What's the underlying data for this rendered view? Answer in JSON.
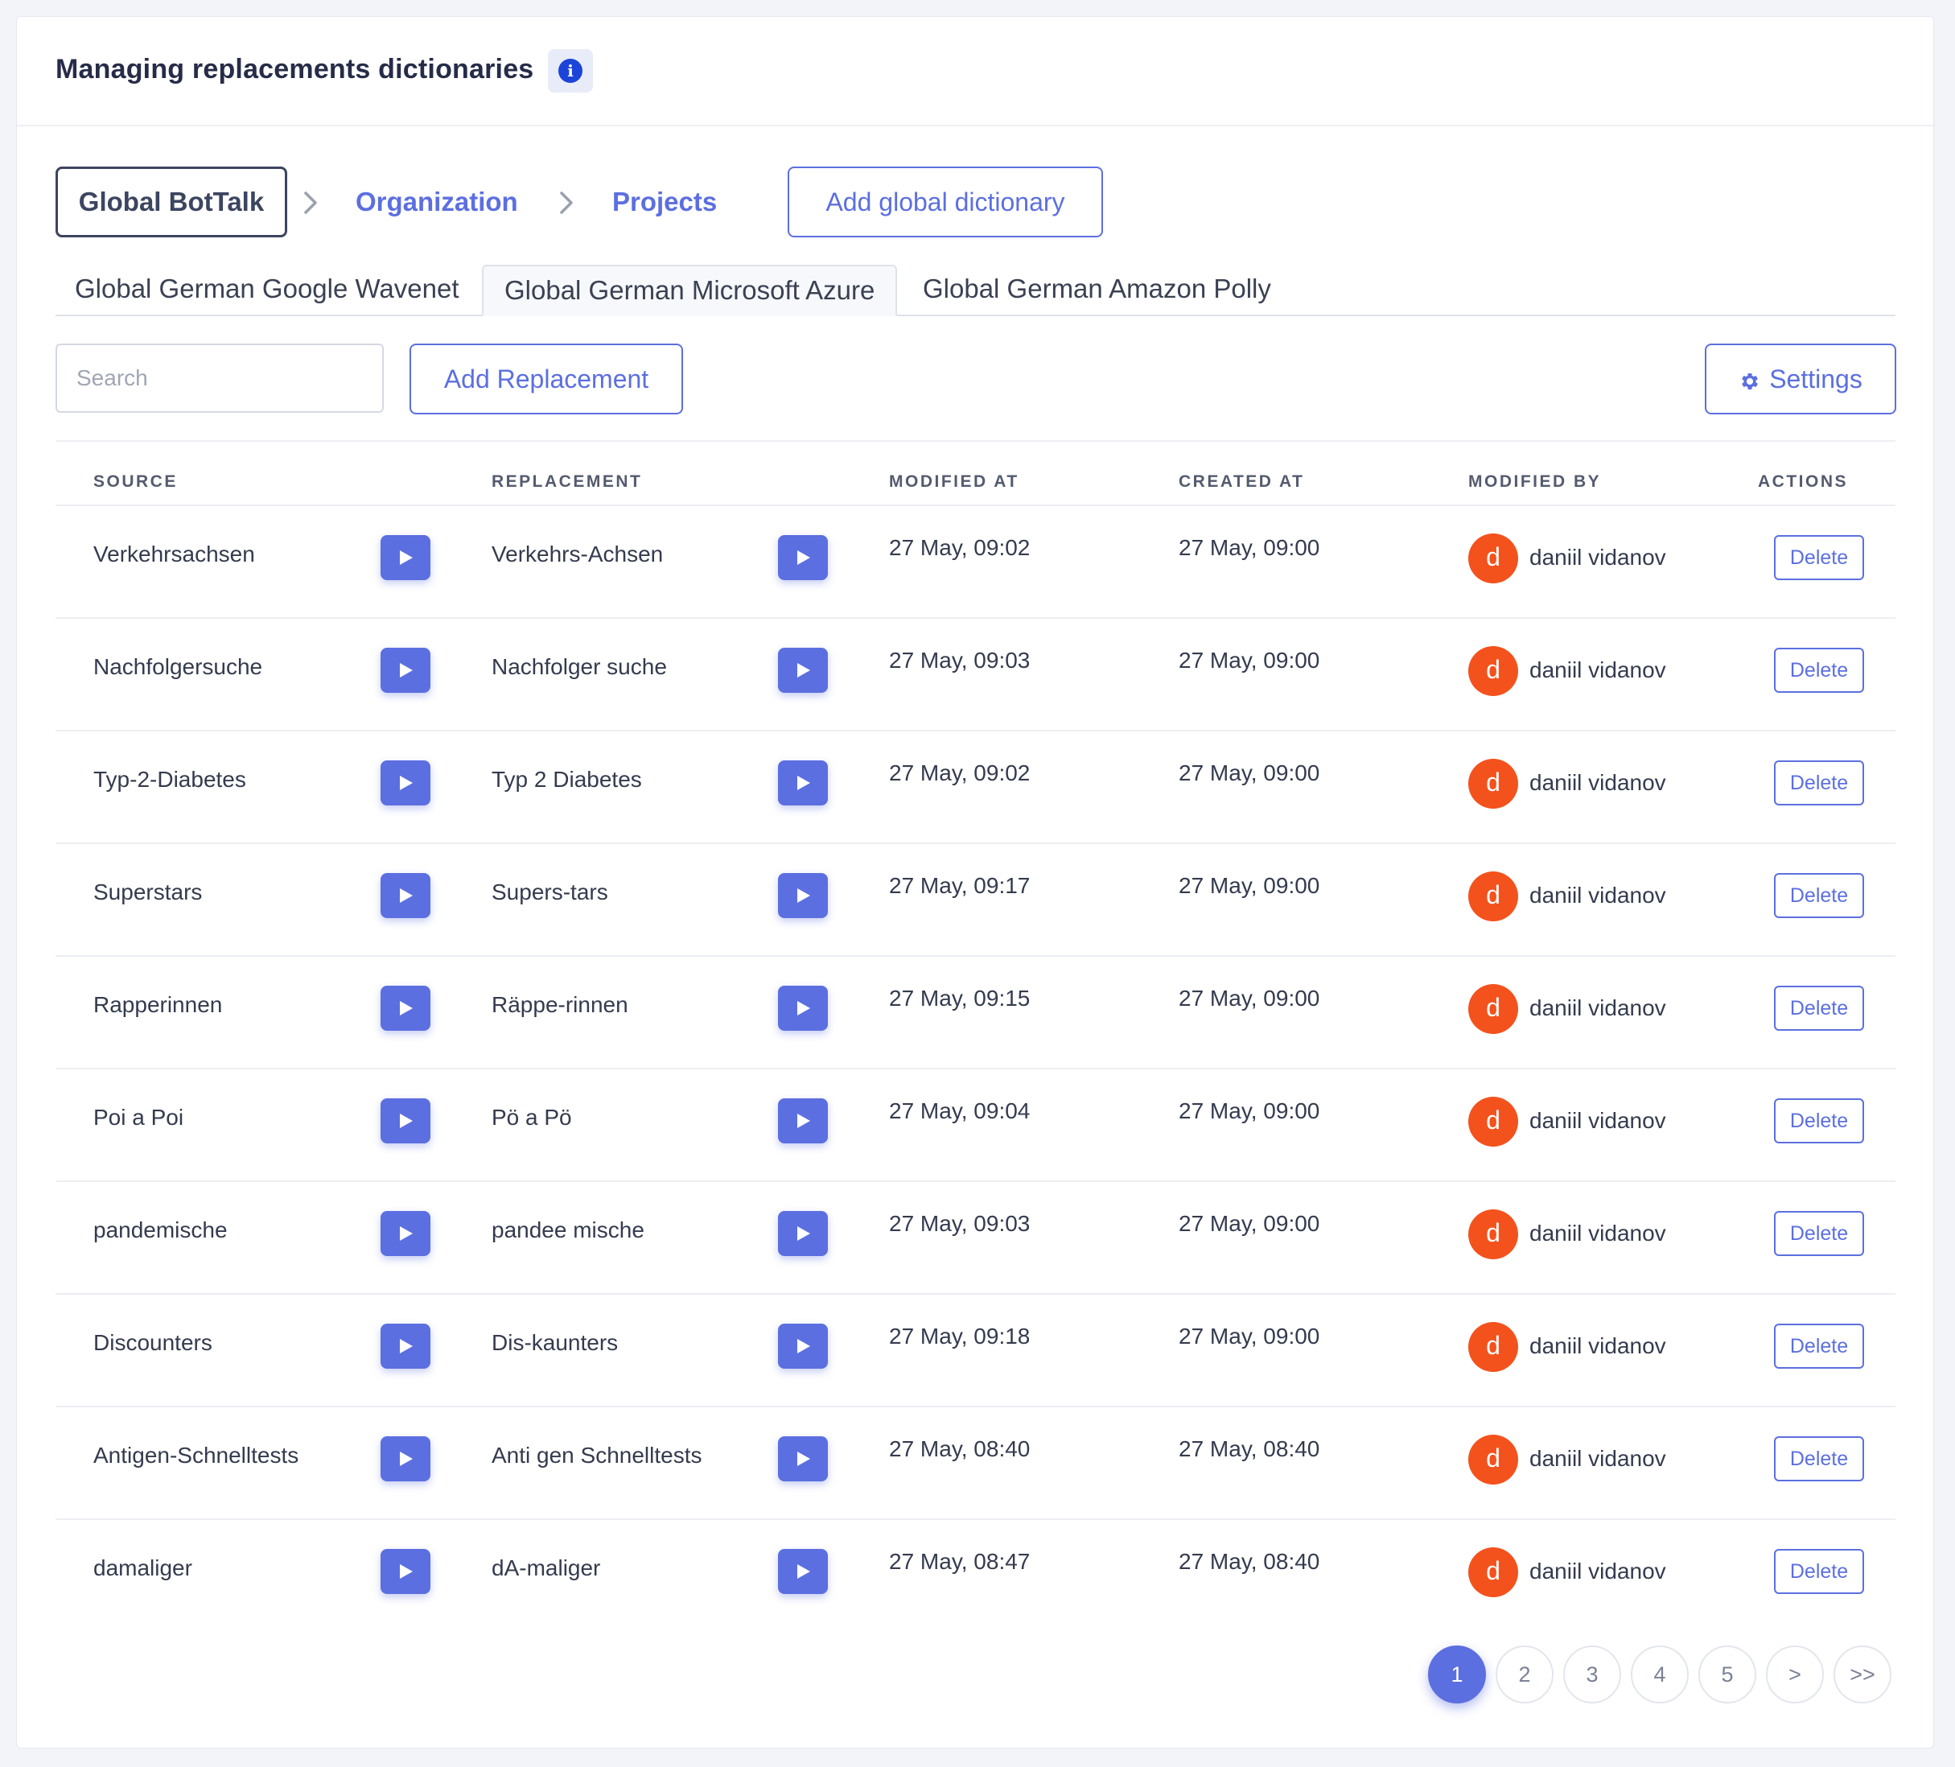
{
  "header": {
    "title": "Managing replacements dictionaries",
    "info_icon": "info-icon"
  },
  "breadcrumb": {
    "items": [
      "Global BotTalk",
      "Organization",
      "Projects"
    ],
    "add_button": "Add global dictionary"
  },
  "tabs": [
    {
      "label": "Global German Google Wavenet",
      "active": false
    },
    {
      "label": "Global German Microsoft Azure",
      "active": true
    },
    {
      "label": "Global German Amazon Polly",
      "active": false
    }
  ],
  "toolbar": {
    "search_placeholder": "Search",
    "search_value": "",
    "add_label": "Add Replacement",
    "settings_label": "Settings",
    "settings_icon": "gear-icon"
  },
  "table": {
    "columns": [
      "SOURCE",
      "REPLACEMENT",
      "MODIFIED AT",
      "CREATED AT",
      "MODIFIED BY",
      "ACTIONS"
    ],
    "delete_label": "Delete",
    "rows": [
      {
        "source": "Verkehrsachsen",
        "replacement": "Verkehrs-Achsen",
        "modified_at": "27 May, 09:02",
        "created_at": "27 May, 09:00",
        "avatar": "d",
        "user": "daniil vidanov"
      },
      {
        "source": "Nachfolgersuche",
        "replacement": "Nachfolger suche",
        "modified_at": "27 May, 09:03",
        "created_at": "27 May, 09:00",
        "avatar": "d",
        "user": "daniil vidanov"
      },
      {
        "source": "Typ-2-Diabetes",
        "replacement": "Typ 2 Diabetes",
        "modified_at": "27 May, 09:02",
        "created_at": "27 May, 09:00",
        "avatar": "d",
        "user": "daniil vidanov"
      },
      {
        "source": "Superstars",
        "replacement": "Supers-tars",
        "modified_at": "27 May, 09:17",
        "created_at": "27 May, 09:00",
        "avatar": "d",
        "user": "daniil vidanov"
      },
      {
        "source": "Rapperinnen",
        "replacement": "Räppe-rinnen",
        "modified_at": "27 May, 09:15",
        "created_at": "27 May, 09:00",
        "avatar": "d",
        "user": "daniil vidanov"
      },
      {
        "source": "Poi a Poi",
        "replacement": "Pö a Pö",
        "modified_at": "27 May, 09:04",
        "created_at": "27 May, 09:00",
        "avatar": "d",
        "user": "daniil vidanov"
      },
      {
        "source": "pandemische",
        "replacement": "pandee mische",
        "modified_at": "27 May, 09:03",
        "created_at": "27 May, 09:00",
        "avatar": "d",
        "user": "daniil vidanov"
      },
      {
        "source": "Discounters",
        "replacement": "Dis-kaunters",
        "modified_at": "27 May, 09:18",
        "created_at": "27 May, 09:00",
        "avatar": "d",
        "user": "daniil vidanov"
      },
      {
        "source": "Antigen-Schnelltests",
        "replacement": "Anti gen Schnelltests",
        "modified_at": "27 May, 08:40",
        "created_at": "27 May, 08:40",
        "avatar": "d",
        "user": "daniil vidanov"
      },
      {
        "source": "damaliger",
        "replacement": "dA-maliger",
        "modified_at": "27 May, 08:47",
        "created_at": "27 May, 08:40",
        "avatar": "d",
        "user": "daniil vidanov"
      }
    ]
  },
  "pagination": {
    "pages": [
      "1",
      "2",
      "3",
      "4",
      "5",
      ">",
      ">>"
    ],
    "current": "1"
  },
  "colors": {
    "accent": "#5c6fe0",
    "avatar": "#f4521d",
    "info": "#1c44d8",
    "text": "#343b4e"
  }
}
